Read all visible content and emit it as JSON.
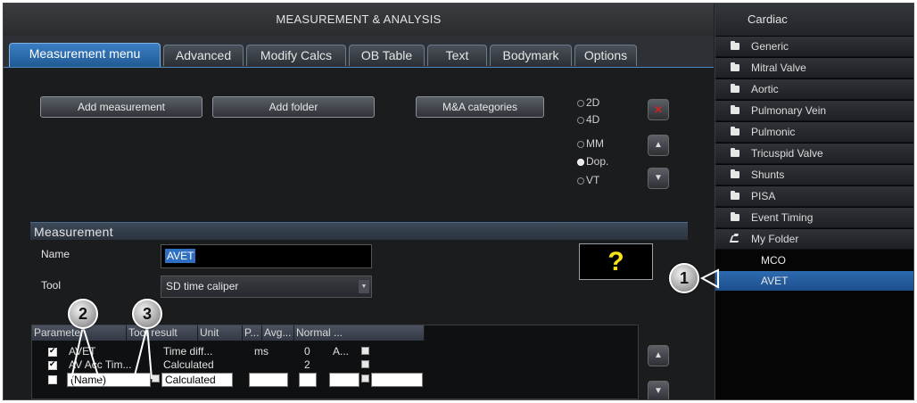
{
  "window": {
    "title": "MEASUREMENT & ANALYSIS"
  },
  "tabs": [
    {
      "label": "Measurement menu",
      "active": true
    },
    {
      "label": "Advanced"
    },
    {
      "label": "Modify Calcs"
    },
    {
      "label": "OB Table"
    },
    {
      "label": "Text"
    },
    {
      "label": "Bodymark"
    },
    {
      "label": "Options"
    }
  ],
  "actions": {
    "add_measurement": "Add measurement",
    "add_folder": "Add folder",
    "categories": "M&A categories"
  },
  "modes": [
    {
      "label": "2D",
      "selected": false
    },
    {
      "label": "4D",
      "selected": false
    },
    {
      "label": "MM",
      "selected": false
    },
    {
      "label": "Dop.",
      "selected": true
    },
    {
      "label": "VT",
      "selected": false
    }
  ],
  "side_buttons": {
    "delete_glyph": "✕",
    "up_glyph": "▲",
    "down_glyph": "▼"
  },
  "measurement": {
    "header": "Measurement",
    "name_label": "Name",
    "name_value": "AVET",
    "tool_label": "Tool",
    "tool_value": "SD time caliper",
    "help_symbol": "?"
  },
  "table": {
    "columns": [
      "Parameter",
      "Tool result",
      "Unit",
      "P...",
      "Avg...",
      "Normal ..."
    ],
    "rows": [
      {
        "checked": true,
        "parameter": "AVET",
        "tool_result": "Time diff...",
        "unit": "ms",
        "p": "0",
        "avg": "A..."
      },
      {
        "checked": true,
        "parameter": "AV Acc Tim...",
        "tool_result": "Calculated",
        "unit": "",
        "p": "2",
        "avg": ""
      },
      {
        "checked": false,
        "parameter": "(Name)",
        "tool_result": "Calculated",
        "unit": "",
        "p": "",
        "avg": ""
      }
    ]
  },
  "sidebar": {
    "title": "Cardiac",
    "items": [
      {
        "label": "Generic"
      },
      {
        "label": "Mitral Valve"
      },
      {
        "label": "Aortic"
      },
      {
        "label": "Pulmonary Vein"
      },
      {
        "label": "Pulmonic"
      },
      {
        "label": "Tricuspid Valve"
      },
      {
        "label": "Shunts"
      },
      {
        "label": "PISA"
      },
      {
        "label": "Event Timing"
      },
      {
        "label": "My Folder",
        "open": true
      }
    ],
    "subitems": [
      {
        "label": "MCO"
      },
      {
        "label": "AVET",
        "selected": true
      }
    ]
  },
  "callouts": [
    "1",
    "2",
    "3"
  ],
  "colors": {
    "accent": "#2f6fc1",
    "help_symbol": "#f7e11a",
    "delete": "#d02020"
  }
}
